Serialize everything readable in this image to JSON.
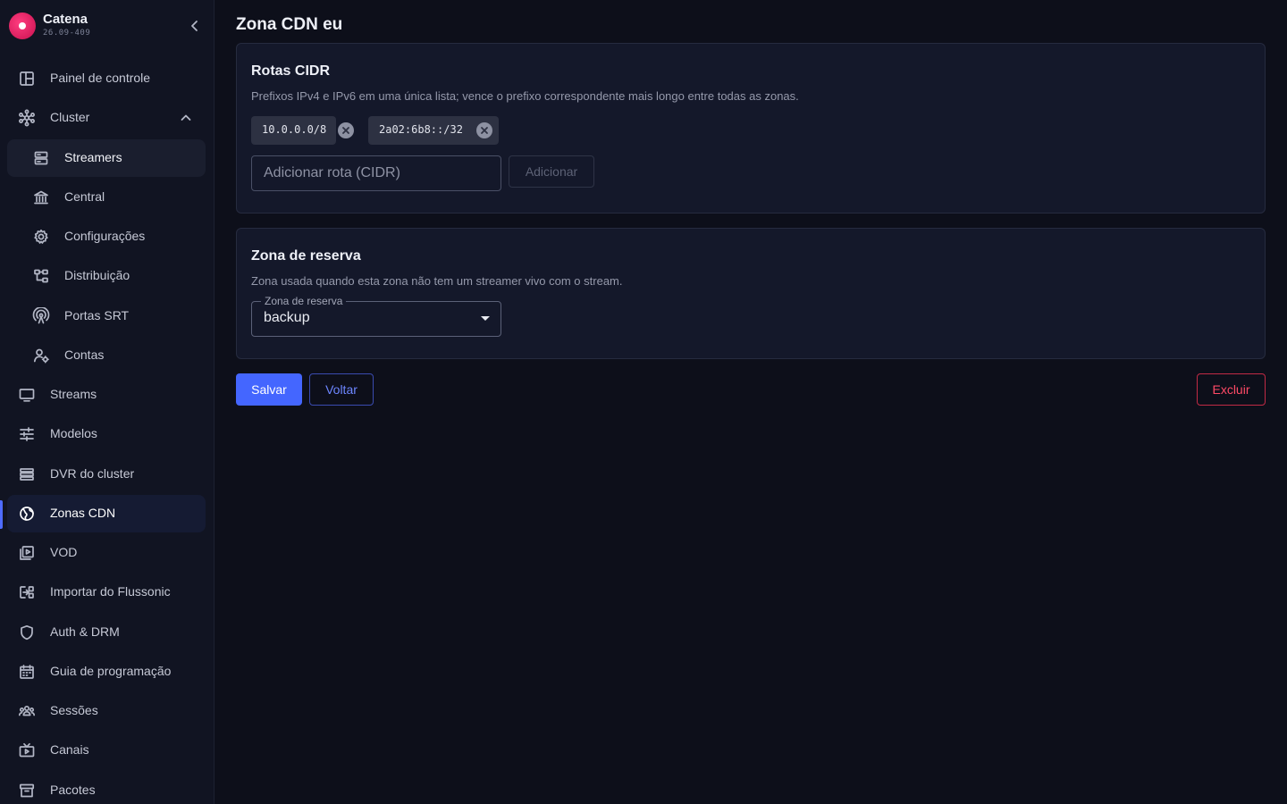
{
  "app": {
    "name": "Catena",
    "version": "26.09-409"
  },
  "colors": {
    "accent": "#4466ff",
    "danger": "#ff4a66",
    "brand": "#e0185f",
    "background": "#0d0f1a"
  },
  "sidebar": {
    "collapse_icon": "chevron-left-icon",
    "items": [
      {
        "label": "Painel de controle",
        "icon": "dashboard-icon"
      },
      {
        "label": "Cluster",
        "icon": "cluster-icon",
        "expanded": true
      },
      {
        "label": "Streamers",
        "icon": "server-icon",
        "selected": true
      },
      {
        "label": "Central",
        "icon": "bank-icon"
      },
      {
        "label": "Configurações",
        "icon": "gear-icon"
      },
      {
        "label": "Distribuição",
        "icon": "distribution-icon"
      },
      {
        "label": "Portas SRT",
        "icon": "antenna-icon"
      },
      {
        "label": "Contas",
        "icon": "accounts-icon"
      },
      {
        "label": "Streams",
        "icon": "monitor-icon"
      },
      {
        "label": "Modelos",
        "icon": "sliders-icon"
      },
      {
        "label": "DVR do cluster",
        "icon": "storage-icon"
      },
      {
        "label": "Zonas CDN",
        "icon": "globe-icon",
        "active": true
      },
      {
        "label": "VOD",
        "icon": "video-library-icon"
      },
      {
        "label": "Importar do Flussonic",
        "icon": "import-icon"
      },
      {
        "label": "Auth & DRM",
        "icon": "shield-icon"
      },
      {
        "label": "Guia de programação",
        "icon": "calendar-icon"
      },
      {
        "label": "Sessões",
        "icon": "users-icon"
      },
      {
        "label": "Canais",
        "icon": "tv-icon"
      },
      {
        "label": "Pacotes",
        "icon": "archive-icon"
      }
    ]
  },
  "page": {
    "title": "Zona CDN eu"
  },
  "routes_card": {
    "title": "Rotas CIDR",
    "description": "Prefixos IPv4 e IPv6 em uma única lista; vence o prefixo correspondente mais longo entre todas as zonas.",
    "chips": [
      "10.0.0.0/8",
      "2a02:6b8::/32"
    ],
    "input_placeholder": "Adicionar rota (CIDR)",
    "input_value": "",
    "add_label": "Adicionar"
  },
  "fallback_card": {
    "title": "Zona de reserva",
    "description": "Zona usada quando esta zona não tem um streamer vivo com o stream.",
    "select_label": "Zona de reserva",
    "select_value": "backup"
  },
  "actions": {
    "save_label": "Salvar",
    "back_label": "Voltar",
    "delete_label": "Excluir"
  }
}
